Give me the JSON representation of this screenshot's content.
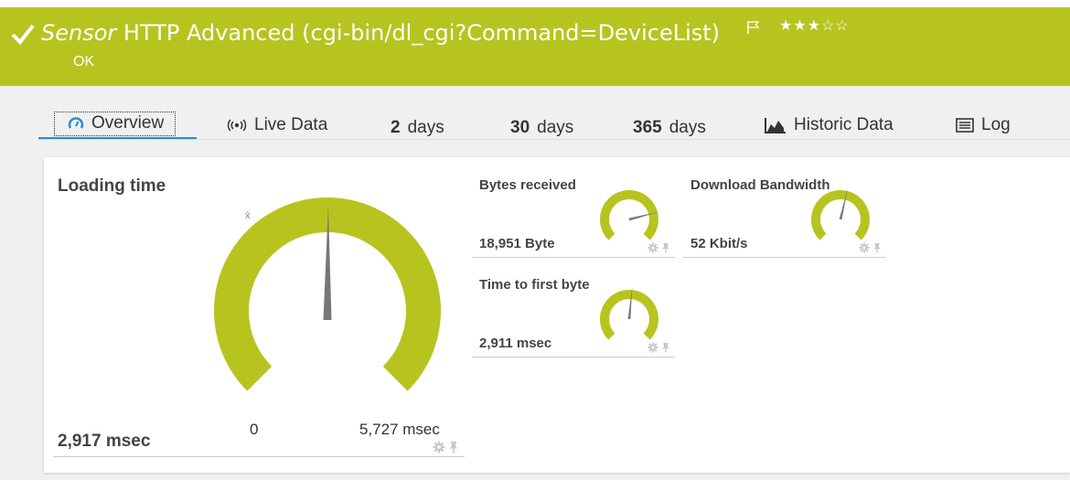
{
  "header": {
    "title_prefix": "Sensor",
    "title_main": "HTTP Advanced (cgi-bin/dl_cgi?Command=DeviceList)",
    "stars": "★★★☆☆",
    "status": "OK"
  },
  "tabs": [
    {
      "label": "Overview",
      "icon": "gauge-icon"
    },
    {
      "label": "Live Data",
      "icon": "radio-waves-icon"
    },
    {
      "num": "2",
      "label": "days"
    },
    {
      "num": "30",
      "label": "days"
    },
    {
      "num": "365",
      "label": "days"
    },
    {
      "label": "Historic Data",
      "icon": "area-chart-icon"
    },
    {
      "label": "Log",
      "icon": "list-icon"
    }
  ],
  "main_gauge": {
    "title": "Loading time",
    "value": "2,917 msec",
    "min_label": "0",
    "max_label": "5,727 msec",
    "avg_symbol": "x̄",
    "fraction": 0.509
  },
  "mini_gauges": [
    {
      "title": "Bytes received",
      "value": "18,951 Byte",
      "fraction": 0.78
    },
    {
      "title": "Download Bandwidth",
      "value": "52 Kbit/s",
      "fraction": 0.55
    },
    {
      "title": "Time to first byte",
      "value": "2,911 msec",
      "fraction": 0.52
    }
  ],
  "colors": {
    "header_bg": "#b7c41f",
    "gauge": "#b7c41f",
    "needle": "#777777",
    "active_tab": "#2a8ad8"
  }
}
